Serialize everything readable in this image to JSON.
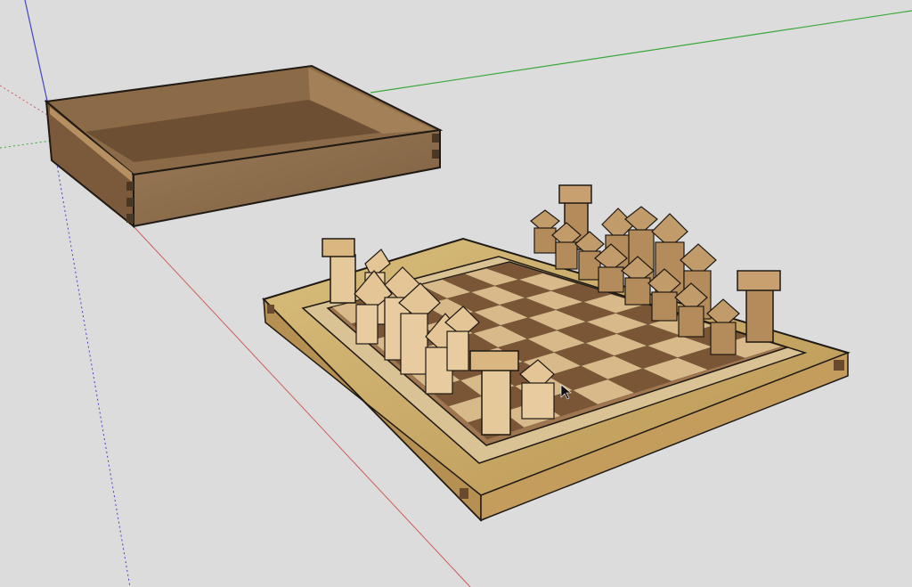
{
  "app": {
    "type": "3d-modeling-viewport"
  },
  "scene": {
    "background_color": "#dcdcdc",
    "axis_colors": {
      "red": "#d25a5a",
      "green": "#3aa83a",
      "blue": "#4a4ac8"
    },
    "objects": [
      "box-tray",
      "chess-board",
      "chess-pieces"
    ]
  },
  "cursor": {
    "icon": "arrow-pointer-icon"
  },
  "colors": {
    "light_wood": "#d7b98a",
    "dark_wood": "#7a5637",
    "frame_wood": "#c9a55f",
    "tray_wood": "#8a6a48"
  }
}
